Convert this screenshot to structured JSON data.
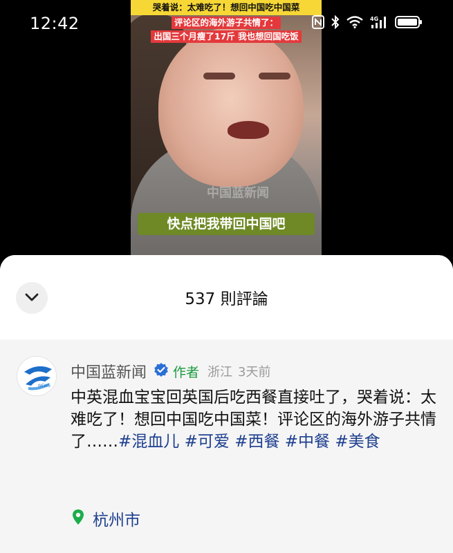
{
  "status_bar": {
    "time": "12:42",
    "icons": [
      "nfc-icon",
      "bluetooth-icon",
      "wifi-icon",
      "signal-4g-icon",
      "battery-icon"
    ],
    "network_label": "4G"
  },
  "video": {
    "top_caption": "哭着说：太难吃了！想回中国吃中国菜",
    "caption_line_1": "评论区的海外游子共情了：",
    "caption_line_2": "出国三个月瘦了17斤 我也想回国吃饭",
    "sub_caption": "快点把我带回中国吧",
    "watermark": "中国蓝新闻"
  },
  "sheet": {
    "title": "537 則評論",
    "collapse_icon": "chevron-down-icon"
  },
  "comment": {
    "author": "中国蓝新闻",
    "author_tag": "作者",
    "location_meta": "浙江",
    "time_meta": "3天前",
    "text_plain": "中英混血宝宝回英国后吃西餐直接吐了，哭着说：太难吃了！想回中国吃中国菜！评论区的海外游子共情了……",
    "hashtags": [
      "#混血儿",
      "#可爱",
      "#西餐",
      "#中餐",
      "#美食"
    ],
    "location": "杭州市"
  },
  "colors": {
    "hashtag": "#1d3f8f",
    "author_tag": "#1a9c3e",
    "verified": "#2b6fd6",
    "pin": "#1aae4a",
    "caption_yellow": "#f6d736",
    "caption_red": "#e4393c"
  }
}
